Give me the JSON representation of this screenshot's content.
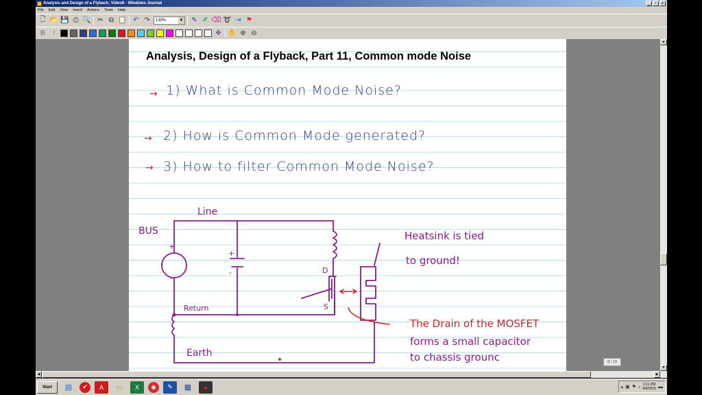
{
  "window": {
    "title": "Analysis and Design of a Flyback; Video9 - Windows Journal",
    "minimize": "_",
    "restore": "▫",
    "close": "x"
  },
  "menu": [
    "File",
    "Edit",
    "View",
    "Insert",
    "Actions",
    "Tools",
    "Help"
  ],
  "toolbar": {
    "zoom": "130%"
  },
  "colors": [
    "#000000",
    "#666666",
    "#2b3a8f",
    "#1f6fe0",
    "#00a651",
    "#008000",
    "#e0141e",
    "#ff8c00",
    "#4fd1ff",
    "#7ed321",
    "#ffff00",
    "#ff00ff"
  ],
  "page": {
    "title": "Analysis, Design of a Flyback, Part 11, Common mode Noise",
    "questions": [
      "1) What is Common Mode Noise?",
      "2) How is Common Mode generated?",
      "3) How to filter Common Mode Noise?"
    ],
    "circuit": {
      "line": "Line",
      "bus": "BUS",
      "return": "Return",
      "earth": "Earth",
      "drain": "D",
      "source": "S",
      "plus": "+",
      "minus": "-"
    },
    "notes": {
      "heatsink_1": "Heatsink is tied",
      "heatsink_2": "to ground!",
      "drain_1": "The Drain of the MOSFET",
      "drain_2": "forms a small capacitor",
      "drain_3": "to chassis grounc"
    }
  },
  "status": {
    "page_count": "8 / 10"
  },
  "taskbar": {
    "start": "Start",
    "time": "2:11 PM",
    "date": "4/9/2015"
  }
}
